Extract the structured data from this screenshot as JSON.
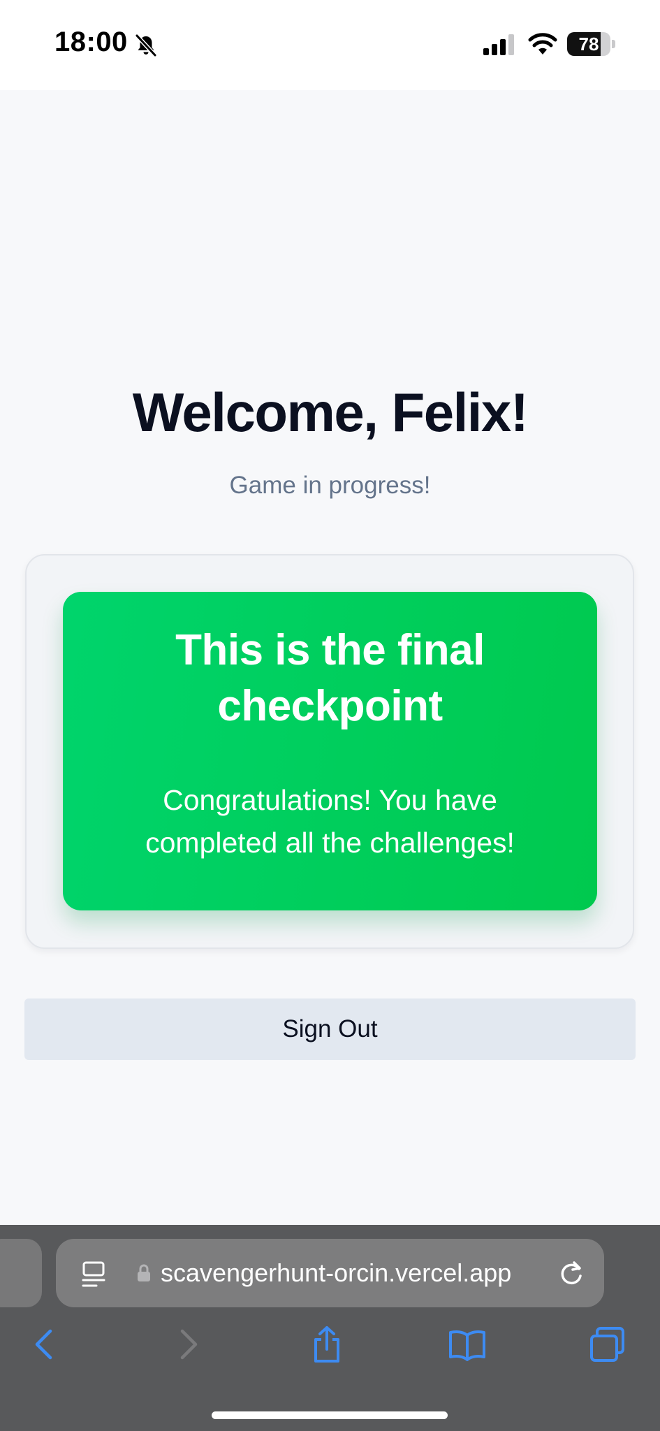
{
  "status_bar": {
    "time": "18:00",
    "battery_level": "78",
    "icons": [
      "bell-slash-icon",
      "cellular-signal-icon",
      "wifi-icon",
      "battery-icon"
    ]
  },
  "main": {
    "title": "Welcome, Felix!",
    "subtitle": "Game in progress!",
    "checkpoint": {
      "title": "This is the final checkpoint",
      "message": "Congratulations! You have completed all the challenges!"
    },
    "sign_out_label": "Sign Out"
  },
  "browser": {
    "url": "scavengerhunt-orcin.vercel.app",
    "toolbar_icons": [
      "back-icon",
      "forward-icon",
      "share-icon",
      "bookmarks-icon",
      "tabs-icon"
    ]
  },
  "colors": {
    "accent_green": "#00cf5e",
    "page_background": "#f7f8fa",
    "button_background": "#e2e8f0",
    "safari_link_blue": "#3d8bf2"
  }
}
